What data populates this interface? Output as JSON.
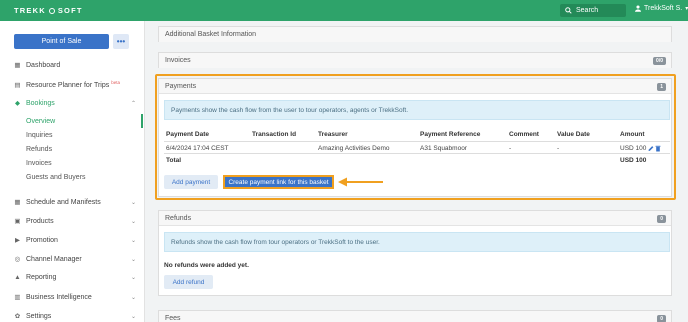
{
  "topbar": {
    "logo_text_1": "TREKK",
    "logo_text_2": "SOFT",
    "search_placeholder": "Search",
    "user_name": "TrekkSoft S.",
    "user_caret": "▾"
  },
  "sidebar": {
    "pos_label": "Point of Sale",
    "more_label": "•••",
    "items": [
      {
        "label": "Dashboard",
        "icon": "▦"
      },
      {
        "label": "Resource Planner for Trips",
        "icon": "▤",
        "beta": "beta"
      },
      {
        "label": "Bookings",
        "icon": "◆",
        "chev": "⌃"
      },
      {
        "label": "Schedule and Manifests",
        "icon": "▦",
        "chev": "⌄"
      },
      {
        "label": "Products",
        "icon": "▣",
        "chev": "⌄"
      },
      {
        "label": "Promotion",
        "icon": "▶",
        "chev": "⌄"
      },
      {
        "label": "Channel Manager",
        "icon": "◎",
        "chev": "⌄"
      },
      {
        "label": "Reporting",
        "icon": "▲",
        "chev": "⌄"
      },
      {
        "label": "Business Intelligence",
        "icon": "▥",
        "chev": "⌄"
      },
      {
        "label": "Settings",
        "icon": "✿",
        "chev": "⌄"
      }
    ],
    "sub_items": [
      "Overview",
      "Inquiries",
      "Refunds",
      "Invoices",
      "Guests and Buyers"
    ]
  },
  "main": {
    "additional_basket": "Additional Basket Information",
    "invoices": {
      "title": "Invoices",
      "badge": "0/0"
    },
    "payments": {
      "title": "Payments",
      "badge": "1",
      "info": "Payments show the cash flow from the user to tour operators, agents or TrekkSoft.",
      "columns": [
        "Payment Date",
        "Transaction Id",
        "Treasurer",
        "Payment Reference",
        "Comment",
        "Value Date",
        "Amount"
      ],
      "row": {
        "date": "6/4/2024 17:04 CEST",
        "transaction_id": "",
        "treasurer": "Amazing Activities Demo",
        "reference": "A31 Squabmoor",
        "comment": "-",
        "value_date": "-",
        "amount": "USD 100"
      },
      "total_label": "Total",
      "total_amount": "USD 100",
      "add_payment": "Add payment",
      "create_link": "Create payment link for this basket"
    },
    "refunds": {
      "title": "Refunds",
      "badge": "0",
      "info": "Refunds show the cash flow from tour operators or TrekkSoft to the user.",
      "empty": "No refunds were added yet.",
      "add_refund": "Add refund"
    },
    "fees": {
      "title": "Fees",
      "badge": "0"
    }
  },
  "colors": {
    "brand": "#2ea36a",
    "primary": "#3a73c8",
    "highlight": "#f0a020"
  }
}
